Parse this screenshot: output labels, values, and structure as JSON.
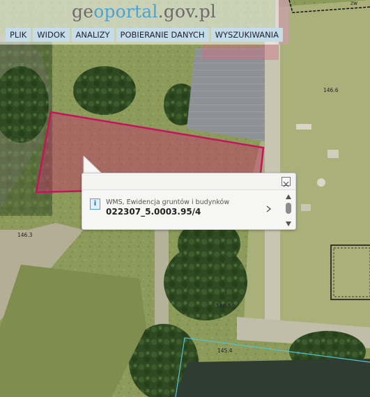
{
  "app": {
    "logo_part1": "ge",
    "logo_part2": "oportal",
    "logo_part3": ".gov.pl"
  },
  "menu": [
    {
      "label": "PLIK"
    },
    {
      "label": "WIDOK"
    },
    {
      "label": "ANALIZY"
    },
    {
      "label": "POBIERANIE DANYCH"
    },
    {
      "label": "WYSZUKIWANIA"
    }
  ],
  "map": {
    "elevations": [
      "146.6",
      "146.3",
      "146.8",
      "145.4"
    ],
    "corner_label": "zw",
    "colors": {
      "parcel_outline": "#c4145e",
      "parcel_fill": "rgba(205,40,110,0.42)",
      "building_outline": "#111111",
      "water_line": "#54c3d8"
    }
  },
  "popup": {
    "layer_name": "WMS, Ewidencja gruntów i budynków",
    "parcel_id": "022307_5.0003.95/4",
    "info_icon": "info-icon",
    "close_icon": "close-icon",
    "next_icon": "chevron-right-icon"
  }
}
